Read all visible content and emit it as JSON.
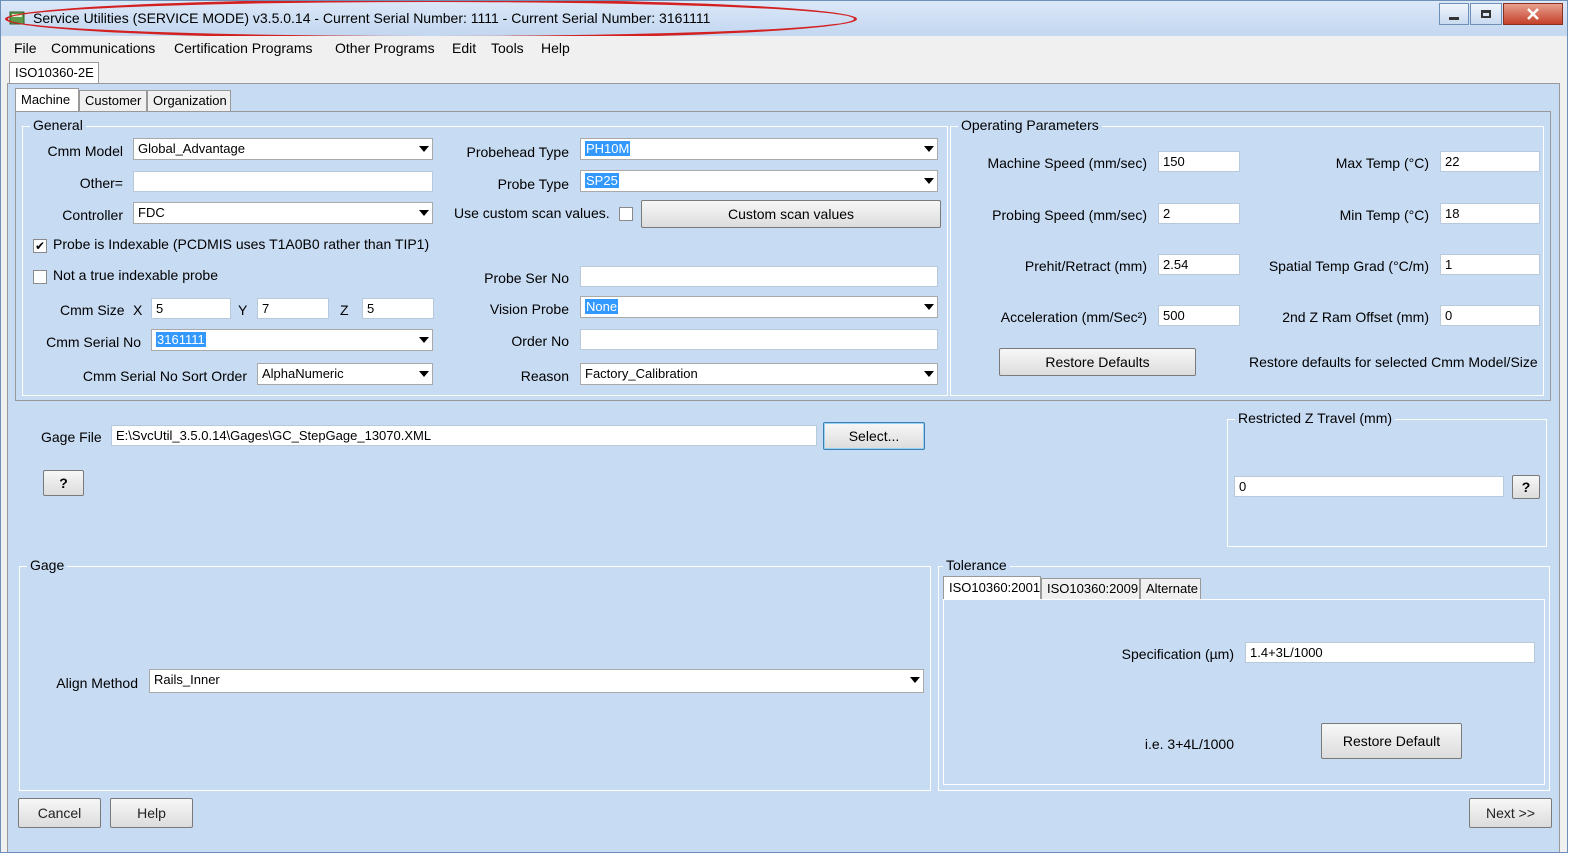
{
  "window": {
    "title": "Service Utilities (SERVICE MODE) v3.5.0.14 - Current Serial Number:  1111 - Current Serial Number:  3161111",
    "minimize_icon": "minimize-icon",
    "maximize_icon": "maximize-icon",
    "close_icon": "close-icon",
    "annotation_color": "#d32020"
  },
  "menu": [
    "File",
    "Communications",
    "Certification Programs",
    "Other Programs",
    "Edit",
    "Tools",
    "Help"
  ],
  "doc_tab": "ISO10360-2E",
  "tabs": [
    "Machine",
    "Customer",
    "Organization"
  ],
  "general": {
    "title": "General",
    "cmm_model_label": "Cmm Model",
    "cmm_model_value": "Global_Advantage",
    "other_label": "Other=",
    "other_value": "",
    "controller_label": "Controller",
    "controller_value": "FDC",
    "indexable_label": "Probe is Indexable (PCDMIS uses T1A0B0 rather than TIP1)",
    "indexable_checked": true,
    "not_indexable_label": "Not a true indexable probe",
    "not_indexable_checked": false,
    "cmm_size_label": "Cmm Size",
    "x_label": "X",
    "x_value": "5",
    "y_label": "Y",
    "y_value": "7",
    "z_label": "Z",
    "z_value": "5",
    "serial_label": "Cmm Serial No",
    "serial_value": "3161111",
    "sort_label": "Cmm Serial No Sort Order",
    "sort_value": "AlphaNumeric",
    "probehead_label": "Probehead Type",
    "probehead_value": "PH10M",
    "probe_type_label": "Probe Type",
    "probe_type_value": "SP25",
    "custom_scan_label": "Use custom scan values.",
    "custom_scan_checked": false,
    "custom_scan_button": "Custom scan values",
    "probe_ser_label": "Probe Ser No",
    "probe_ser_value": "",
    "vision_label": "Vision Probe",
    "vision_value": "None",
    "order_label": "Order No",
    "order_value": "",
    "reason_label": "Reason",
    "reason_value": "Factory_Calibration"
  },
  "operating": {
    "title": "Operating Parameters",
    "machine_speed_label": "Machine Speed (mm/sec)",
    "machine_speed_value": "150",
    "probing_speed_label": "Probing Speed (mm/sec)",
    "probing_speed_value": "2",
    "prehit_label": "Prehit/Retract (mm)",
    "prehit_value": "2.54",
    "accel_label": "Acceleration (mm/Sec²)",
    "accel_value": "500",
    "max_temp_label": "Max Temp (°C)",
    "max_temp_value": "22",
    "min_temp_label": "Min Temp (°C)",
    "min_temp_value": "18",
    "spatial_label": "Spatial Temp Grad (°C/m)",
    "spatial_value": "1",
    "ram_label": "2nd Z Ram Offset (mm)",
    "ram_value": "0",
    "restore_button": "Restore Defaults",
    "restore_note": "Restore defaults for selected Cmm Model/Size"
  },
  "gage_file": {
    "label": "Gage File",
    "value": "E:\\SvcUtil_3.5.0.14\\Gages\\GC_StepGage_13070.XML",
    "select_button": "Select...",
    "help_button": "?"
  },
  "restricted": {
    "title": "Restricted Z Travel (mm)",
    "value": "0",
    "help_button": "?"
  },
  "gage": {
    "title": "Gage",
    "align_label": "Align Method",
    "align_value": "Rails_Inner"
  },
  "tolerance": {
    "title": "Tolerance",
    "tabs": [
      "ISO10360:2001",
      "ISO10360:2009",
      "Alternate"
    ],
    "spec_label": "Specification (µm)",
    "spec_value": "1.4+3L/1000",
    "example": "i.e. 3+4L/1000",
    "restore_button": "Restore Default"
  },
  "footer": {
    "cancel": "Cancel",
    "help": "Help",
    "next": "Next >>"
  }
}
